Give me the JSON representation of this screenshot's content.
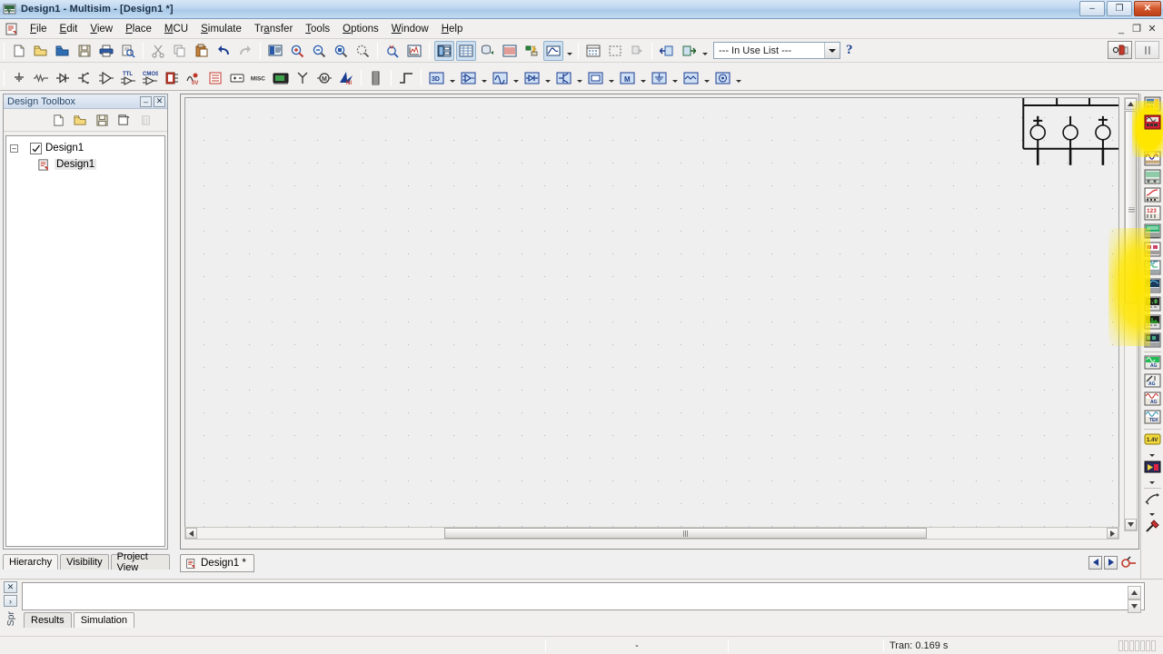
{
  "window": {
    "title": "Design1 - Multisim - [Design1 *]",
    "app_icon": "multisim-icon",
    "minimize": "–",
    "maximize": "❐",
    "close": "✕",
    "mdi_minimize": "_",
    "mdi_restore": "❐",
    "mdi_close": "✕"
  },
  "menu": {
    "items": [
      {
        "label": "File",
        "accel": "F"
      },
      {
        "label": "Edit",
        "accel": "E"
      },
      {
        "label": "View",
        "accel": "V"
      },
      {
        "label": "Place",
        "accel": "P"
      },
      {
        "label": "MCU",
        "accel": "M"
      },
      {
        "label": "Simulate",
        "accel": "S"
      },
      {
        "label": "Transfer",
        "accel": "a"
      },
      {
        "label": "Tools",
        "accel": "T"
      },
      {
        "label": "Options",
        "accel": "O"
      },
      {
        "label": "Window",
        "accel": "W"
      },
      {
        "label": "Help",
        "accel": "H"
      }
    ]
  },
  "standard_toolbar": {
    "buttons": [
      {
        "name": "new-icon",
        "title": "New"
      },
      {
        "name": "open-icon",
        "title": "Open"
      },
      {
        "name": "open-samples-icon",
        "title": "Open samples"
      },
      {
        "name": "save-icon",
        "title": "Save"
      },
      {
        "name": "print-icon",
        "title": "Print"
      },
      {
        "name": "print-preview-icon",
        "title": "Print preview"
      },
      {
        "name": "cut-icon",
        "title": "Cut"
      },
      {
        "name": "copy-icon",
        "title": "Copy"
      },
      {
        "name": "paste-icon",
        "title": "Paste"
      },
      {
        "name": "undo-icon",
        "title": "Undo"
      },
      {
        "name": "redo-icon",
        "title": "Redo"
      },
      {
        "name": "full-screen-icon",
        "title": "Toggle full screen"
      },
      {
        "name": "zoom-in-icon",
        "title": "Zoom in"
      },
      {
        "name": "zoom-out-icon",
        "title": "Zoom out"
      },
      {
        "name": "zoom-area-icon",
        "title": "Zoom area"
      },
      {
        "name": "zoom-fit-icon",
        "title": "Zoom fit to page"
      },
      {
        "name": "zoom-selection-icon",
        "title": "Zoom selection"
      },
      {
        "name": "grapher-icon",
        "title": "Grapher"
      },
      {
        "name": "design-toolbox-icon",
        "title": "Show design toolbox"
      },
      {
        "name": "spreadsheet-view-icon",
        "title": "Show spreadsheet view"
      },
      {
        "name": "database-manager-icon",
        "title": "Database manager"
      },
      {
        "name": "component-wizard-icon",
        "title": "Component wizard"
      },
      {
        "name": "analysis-icon",
        "title": "Analyses"
      },
      {
        "name": "postprocessor-icon",
        "title": "Postprocessor"
      },
      {
        "name": "erc-icon",
        "title": "Electrical rules check"
      },
      {
        "name": "area-capture-icon",
        "title": "Capture screen area"
      },
      {
        "name": "back-annotate-icon",
        "title": "Back annotate"
      },
      {
        "name": "transfer-in-icon",
        "title": "Transfer to Ultiboard"
      },
      {
        "name": "transfer-out-icon",
        "title": "Forward annotate"
      }
    ],
    "in_use_list": {
      "value": "--- In Use List ---",
      "options": [
        "--- In Use List ---"
      ]
    },
    "help_label": "?"
  },
  "components_toolbar": {
    "buttons": [
      {
        "name": "place-source-icon",
        "title": "Place source"
      },
      {
        "name": "place-basic-icon",
        "title": "Place basic"
      },
      {
        "name": "place-diode-icon",
        "title": "Place diode"
      },
      {
        "name": "place-transistor-icon",
        "title": "Place transistor"
      },
      {
        "name": "place-analog-icon",
        "title": "Place analog"
      },
      {
        "name": "place-ttl-icon",
        "title": "Place TTL"
      },
      {
        "name": "place-cmos-icon",
        "title": "Place CMOS"
      },
      {
        "name": "place-misc-digital-icon",
        "title": "Place misc digital"
      },
      {
        "name": "place-mixed-icon",
        "title": "Place mixed"
      },
      {
        "name": "place-indicator-icon",
        "title": "Place indicator"
      },
      {
        "name": "place-power-icon",
        "title": "Place power component"
      },
      {
        "name": "place-misc-icon",
        "title": "Place misc",
        "label": "MISC"
      },
      {
        "name": "place-advanced-peripherals-icon",
        "title": "Place advanced peripherals"
      },
      {
        "name": "place-rf-icon",
        "title": "Place RF"
      },
      {
        "name": "place-electromechanical-icon",
        "title": "Place electromechanical"
      },
      {
        "name": "place-ni-components-icon",
        "title": "Place NI components"
      },
      {
        "name": "place-connectors-icon",
        "title": "Place connectors"
      },
      {
        "name": "place-hierarchical-block-icon",
        "title": "Place hierarchical block"
      }
    ],
    "virtual_buttons": [
      {
        "name": "show-3d-components-bar-icon",
        "label": "3D"
      },
      {
        "name": "show-analog-family-bar-icon",
        "label": ""
      },
      {
        "name": "show-signal-source-family-bar-icon",
        "label": ""
      },
      {
        "name": "show-diode-family-bar-icon",
        "label": ""
      },
      {
        "name": "show-transistor-family-bar-icon",
        "label": ""
      },
      {
        "name": "show-measurement-family-bar-icon",
        "label": ""
      },
      {
        "name": "show-misc-family-bar-icon",
        "label": "M"
      },
      {
        "name": "show-power-source-family-bar-icon",
        "label": ""
      },
      {
        "name": "show-rated-family-bar-icon",
        "label": ""
      },
      {
        "name": "show-basic-family-bar-icon",
        "label": ""
      }
    ]
  },
  "simulation_controls": {
    "run_label": "run-simulation-icon",
    "pause_label": "pause-simulation-icon"
  },
  "design_toolbox": {
    "title": "Design Toolbox",
    "collapse_label": "–",
    "close_label": "✕",
    "toolbar": [
      {
        "name": "new-design-icon",
        "title": "New design"
      },
      {
        "name": "open-design-icon",
        "title": "Open design"
      },
      {
        "name": "save-design-icon",
        "title": "Save design"
      },
      {
        "name": "new-sheet-icon",
        "title": "New sheet"
      },
      {
        "name": "delete-sheet-icon",
        "title": "Delete sheet"
      }
    ],
    "tree": {
      "root": {
        "label": "Design1",
        "expander": "–",
        "checked": true
      },
      "child": {
        "label": "Design1",
        "selected": true
      }
    },
    "tabs": [
      {
        "label": "Hierarchy",
        "active": true
      },
      {
        "label": "Visibility",
        "active": false
      },
      {
        "label": "Project View",
        "active": false
      }
    ]
  },
  "document_tabs": {
    "tabs": [
      {
        "label": "Design1 *",
        "active": true,
        "icon": "schematic-icon"
      }
    ],
    "nav_prev": "◀",
    "nav_next": "▶",
    "extra_icon": "component-icon"
  },
  "instruments": {
    "items": [
      {
        "name": "multimeter-icon",
        "title": "Multimeter"
      },
      {
        "name": "function-generator-icon",
        "title": "Function generator",
        "highlighted": true
      },
      {
        "name": "wattmeter-icon",
        "title": "Wattmeter"
      },
      {
        "name": "oscilloscope-icon",
        "title": "Oscilloscope"
      },
      {
        "name": "four-channel-oscilloscope-icon",
        "title": "4 Channel oscilloscope"
      },
      {
        "name": "bode-plotter-icon",
        "title": "Bode plotter"
      },
      {
        "name": "frequency-counter-icon",
        "title": "Frequency counter"
      },
      {
        "name": "word-generator-icon",
        "title": "Word generator"
      },
      {
        "name": "logic-converter-icon",
        "title": "Logic converter"
      },
      {
        "name": "logic-analyzer-icon",
        "title": "Logic analyzer"
      },
      {
        "name": "iv-analyzer-icon",
        "title": "IV analyzer"
      },
      {
        "name": "distortion-analyzer-icon",
        "title": "Distortion analyzer"
      },
      {
        "name": "spectrum-analyzer-icon",
        "title": "Spectrum analyzer"
      },
      {
        "name": "network-analyzer-icon",
        "title": "Network analyzer"
      },
      {
        "name": "agilent-function-generator-icon",
        "title": "Agilent function generator"
      },
      {
        "name": "agilent-multimeter-icon",
        "title": "Agilent multimeter"
      },
      {
        "name": "agilent-oscilloscope-icon",
        "title": "Agilent oscilloscope"
      },
      {
        "name": "tektronix-oscilloscope-icon",
        "title": "Tektronix oscilloscope"
      },
      {
        "name": "measurement-probe-icon",
        "title": "Measurement probe",
        "label": "1.4V"
      },
      {
        "name": "labview-instruments-icon",
        "title": "LabVIEW instruments"
      },
      {
        "name": "current-probe-icon",
        "title": "Current clamp"
      },
      {
        "name": "dynamic-probe-icon",
        "title": "Dynamic measurement probe"
      }
    ]
  },
  "spreadsheet": {
    "close_label": "✕",
    "expand_label": "›",
    "side_label": "Spr",
    "tabs": [
      {
        "label": "Results",
        "active": false
      },
      {
        "label": "Simulation",
        "active": true
      }
    ],
    "scroll_up": "▲",
    "scroll_down": "▼"
  },
  "statusbar": {
    "left": "",
    "middle": "-",
    "right": "",
    "tran_time": "Tran: 0.169 s"
  },
  "canvas": {
    "zoom_hint": "",
    "hscroll_left": "◀",
    "hscroll_right": "▶",
    "vscroll_up": "▲",
    "vscroll_down": "▼",
    "circuit_note": "partial schematic at top-right: three sources on a bus"
  },
  "colors": {
    "title_gradient_start": "#d7e7f7",
    "title_gradient_end": "#a9c9e8",
    "chrome": "#f1f0ef",
    "canvas_bg": "#efefef",
    "grid_dot": "#b9b9b9",
    "highlight": "#ffe600",
    "accent_blue": "#1b3d8f",
    "close_red": "#bd3f16"
  }
}
